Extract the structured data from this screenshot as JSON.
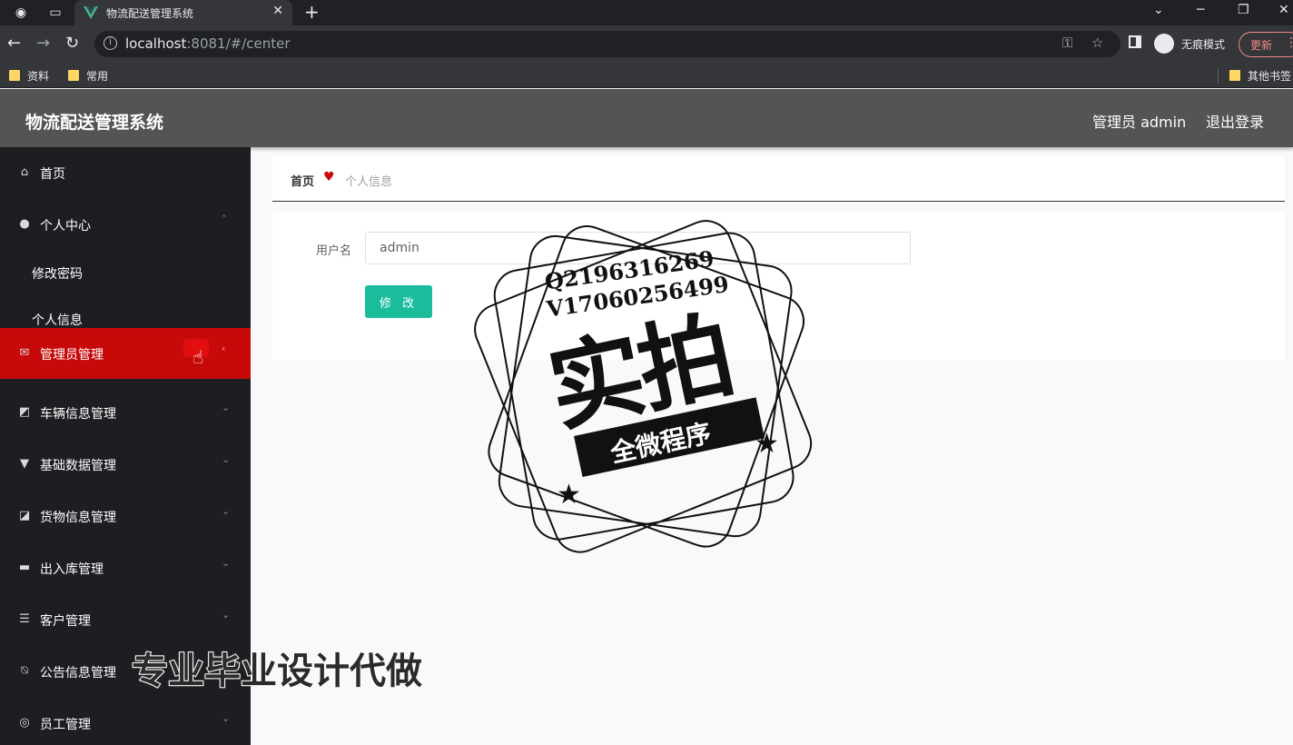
{
  "browser": {
    "tab_title": "物流配送管理系统",
    "url_host": "localhost",
    "url_rest": ":8081/#/center",
    "incognito_label": "无痕模式",
    "update_label": "更新",
    "bookmarks": [
      "资料",
      "常用"
    ],
    "other_bookmarks": "其他书签"
  },
  "header": {
    "title": "物流配送管理系统",
    "user": "管理员 admin",
    "logout": "退出登录"
  },
  "sidebar": {
    "items": [
      {
        "label": "首页",
        "icon": "home-icon"
      },
      {
        "label": "个人中心",
        "icon": "user-icon"
      },
      {
        "label": "管理员管理",
        "icon": "mail-icon"
      },
      {
        "label": "车辆信息管理",
        "icon": "chart-icon"
      },
      {
        "label": "基础数据管理",
        "icon": "stand-icon"
      },
      {
        "label": "货物信息管理",
        "icon": "goods-icon"
      },
      {
        "label": "出入库管理",
        "icon": "chat-icon"
      },
      {
        "label": "客户管理",
        "icon": "list-icon"
      },
      {
        "label": "公告信息管理",
        "icon": "bell-off-icon"
      },
      {
        "label": "员工管理",
        "icon": "staff-icon"
      }
    ],
    "sub_items": [
      "修改密码",
      "个人信息"
    ]
  },
  "breadcrumb": {
    "home": "首页",
    "current": "个人信息"
  },
  "form": {
    "username_label": "用户名",
    "username_value": "admin",
    "submit_label": "修 改"
  },
  "watermark": {
    "qq": "Q2196316269",
    "vx": "V17060256499",
    "big": "实拍",
    "ribbon": "全微程序",
    "overlay": "专业毕业设计代做"
  },
  "colors": {
    "header_bg": "#545454",
    "sidebar_bg": "#1d1e22",
    "active_bg": "#c70a09",
    "button_bg": "#1abc9c"
  }
}
